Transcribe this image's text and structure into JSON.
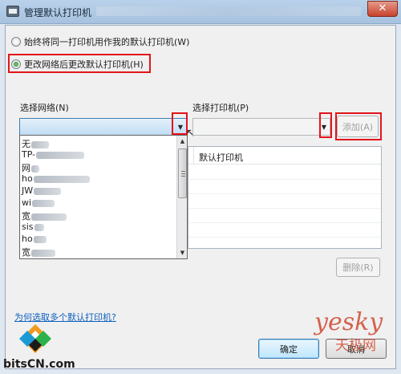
{
  "window": {
    "title": "管理默认打印机",
    "close_glyph": "✕"
  },
  "options": {
    "always_same": "始终将同一打印机用作我的默认打印机(W)",
    "change_by_network": "更改网络后更改默认打印机(H)"
  },
  "network": {
    "label": "选择网络(N)",
    "list": [
      "无",
      "TP-",
      "网",
      "ho",
      "JW",
      "wi",
      "宽",
      "sis",
      "ho",
      "宽"
    ]
  },
  "printer": {
    "label": "选择打印机(P)",
    "add_button": "添加(A)",
    "table_header": "默认打印机",
    "remove_button": "删除(R)"
  },
  "help_link": "为何选取多个默认打印机?",
  "buttons": {
    "ok": "确定",
    "cancel": "取消"
  },
  "branding": {
    "site": "bitsCN.com",
    "watermark_latin": "yesky",
    "watermark_cn": "天极网"
  },
  "colors": {
    "highlight_box": "#e3141b",
    "link": "#0d5fbf"
  }
}
